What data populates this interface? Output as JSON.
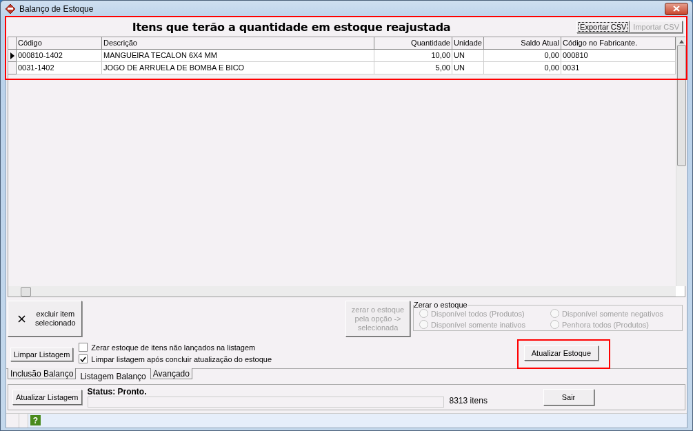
{
  "window": {
    "title": "Balanço de Estoque"
  },
  "header": {
    "title": "Itens que terão a quantidade em estoque reajustada",
    "buttons": [
      {
        "label": "Exportar CSV",
        "disabled": false
      },
      {
        "label": "Importar CSV",
        "disabled": true
      }
    ]
  },
  "table": {
    "columns": [
      "Código",
      "Descrição",
      "Quantidade",
      "Unidade",
      "Saldo Atual",
      "Código no Fabricante."
    ],
    "rows": [
      {
        "selected": true,
        "cells": [
          "000810-1402",
          "MANGUEIRA TECALON 6X4 MM",
          "10,00",
          "UN",
          "0,00",
          "000810"
        ]
      },
      {
        "selected": false,
        "cells": [
          "0031-1402",
          "JOGO DE ARRUELA DE BOMBA E BICO",
          "5,00",
          "UN",
          "0,00",
          "0031"
        ]
      }
    ]
  },
  "delete_button": {
    "label": "excluir item selecionado"
  },
  "zero_button": {
    "label": "zerar o estoque pela opção -> selecionada",
    "disabled": true
  },
  "zero_group": {
    "title": "Zerar o estoque",
    "options": [
      {
        "label": "Disponível todos (Produtos)",
        "selected": false,
        "disabled": true
      },
      {
        "label": "Disponível somente negativos",
        "selected": false,
        "disabled": true
      },
      {
        "label": "Disponível somente inativos",
        "selected": false,
        "disabled": true
      },
      {
        "label": "Penhora todos (Produtos)",
        "selected": false,
        "disabled": true
      }
    ]
  },
  "clear_button": {
    "label": "Limpar Listagem"
  },
  "checkboxes": [
    {
      "label": "Zerar estoque de itens não lançados na listagem",
      "checked": false
    },
    {
      "label": "Limpar listagem após concluir atualização do estoque",
      "checked": true
    }
  ],
  "update_stock_button": {
    "label": "Atualizar Estoque"
  },
  "tabs": [
    {
      "label": "Inclusão Balanço",
      "selected": false
    },
    {
      "label": "Listagem Balanço",
      "selected": true
    },
    {
      "label": "Avançado",
      "selected": false
    }
  ],
  "bottom": {
    "refresh_button": "Atualizar Listagem",
    "status": "Status: Pronto.",
    "progress": {
      "level": 0
    },
    "count": "8313 itens",
    "exit_button": "Sair"
  },
  "status_bar": {
    "help": "?"
  }
}
